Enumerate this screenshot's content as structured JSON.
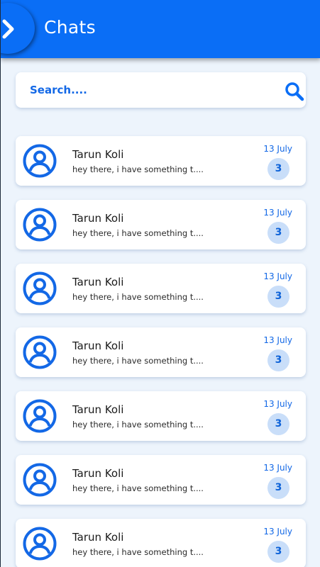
{
  "header": {
    "title": "Chats"
  },
  "search": {
    "placeholder": "Search...."
  },
  "chats": [
    {
      "name": "Tarun Koli",
      "preview": "hey there, i have something t....",
      "date": "13 July",
      "unread": "3"
    },
    {
      "name": "Tarun Koli",
      "preview": "hey there, i have something t....",
      "date": "13 July",
      "unread": "3"
    },
    {
      "name": "Tarun Koli",
      "preview": "hey there, i have something t....",
      "date": "13 July",
      "unread": "3"
    },
    {
      "name": "Tarun Koli",
      "preview": "hey there, i have something t....",
      "date": "13 July",
      "unread": "3"
    },
    {
      "name": "Tarun Koli",
      "preview": "hey there, i have something t....",
      "date": "13 July",
      "unread": "3"
    },
    {
      "name": "Tarun Koli",
      "preview": "hey there, i have something t....",
      "date": "13 July",
      "unread": "3"
    },
    {
      "name": "Tarun Koli",
      "preview": "hey there, i have something t....",
      "date": "13 July",
      "unread": "3"
    }
  ],
  "colors": {
    "accent": "#0a6ef6",
    "background": "#edf4fc",
    "badge": "#c9def9"
  },
  "icons": {
    "menu": "chevron-right-icon",
    "search": "search-icon",
    "avatar": "user-circle-icon"
  }
}
